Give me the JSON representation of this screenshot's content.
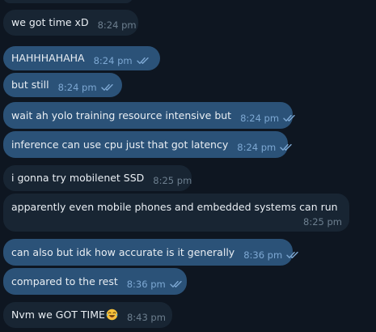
{
  "colors": {
    "background": "#0e1621",
    "incoming_bubble": "#182533",
    "outgoing_bubble": "#2b5278",
    "read_ticks": "#7da8d3"
  },
  "messages": [
    {
      "text": "we got time xD",
      "time": "8:24 pm",
      "direction": "incoming"
    },
    {
      "text": "HAHHHAHAHA",
      "time": "8:24 pm",
      "direction": "outgoing",
      "status": "read-ticks-icon"
    },
    {
      "text": "but still",
      "time": "8:24 pm",
      "direction": "outgoing",
      "status": "read-ticks-icon"
    },
    {
      "text": "wait ah yolo training resource intensive but",
      "time": "8:24 pm",
      "direction": "outgoing",
      "status": "read-ticks-icon"
    },
    {
      "text": "inference can use cpu just that got latency",
      "time": "8:24 pm",
      "direction": "outgoing",
      "status": "read-ticks-icon"
    },
    {
      "text": "i gonna try mobilenet SSD",
      "time": "8:25 pm",
      "direction": "incoming"
    },
    {
      "text": "apparently even mobile phones and embedded systems can run",
      "time": "8:25 pm",
      "direction": "incoming"
    },
    {
      "text": "can also but idk how accurate is it generally",
      "time": "8:36 pm",
      "direction": "outgoing",
      "status": "read-ticks-icon"
    },
    {
      "text": "compared to the rest",
      "time": "8:36 pm",
      "direction": "outgoing",
      "status": "read-ticks-icon"
    },
    {
      "text": "Nvm we GOT TIME",
      "emoji": "laughing-tears-emoji-icon",
      "time": "8:43 pm",
      "direction": "incoming"
    }
  ]
}
